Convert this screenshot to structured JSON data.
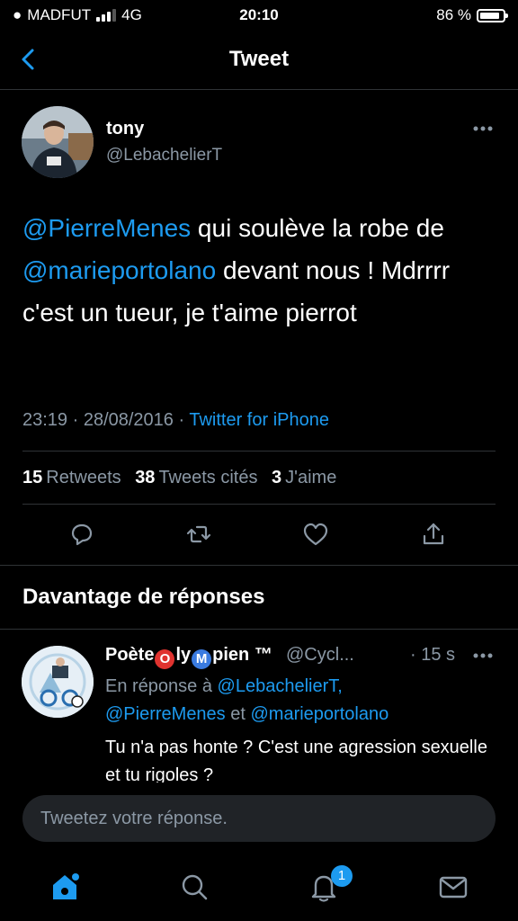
{
  "status_bar": {
    "carrier": "MADFUT",
    "network": "4G",
    "time": "20:10",
    "battery": "86 %",
    "battery_level": 0.86
  },
  "nav": {
    "title": "Tweet",
    "back_icon": "chevron-left-icon"
  },
  "tweet": {
    "name": "tony",
    "handle": "@LebachelierT",
    "text": {
      "mention1": "@PierreMenes",
      "part1": " qui soulève la robe de ",
      "mention2": "@marieportolano",
      "part2": " devant nous ! Mdrrrr c'est un tueur, je t'aime pierrot"
    },
    "time": "23:19 · 28/08/2016 · ",
    "source": "Twitter for iPhone",
    "stats": {
      "retweets_count": "15",
      "retweets_label": "Retweets",
      "quotes_count": "38",
      "quotes_label": "Tweets cités",
      "likes_count": "3",
      "likes_label": "J'aime"
    }
  },
  "more_replies_title": "Davantage de réponses",
  "reply": {
    "name_a": "Poète",
    "name_b": "ly",
    "name_c": "pien ™",
    "emoji1": "O",
    "emoji2": "M",
    "handle": "@Cycl...",
    "time": "· 15 s",
    "in_reply_to_label": "En réponse à ",
    "in_reply_to_1": "@LebachelierT,",
    "in_reply_to_2": "@PierreMenes",
    "in_reply_to_and": " et ",
    "in_reply_to_3": "@marieportolano",
    "text": "Tu n'a pas honte ? C'est une agression sexuelle et tu rigoles ?"
  },
  "composer": {
    "placeholder": "Tweetez votre réponse."
  },
  "tabbar": {
    "notification_badge": "1"
  },
  "colors": {
    "accent": "#1d9bf0",
    "muted": "#8b98a5",
    "background": "#000000"
  }
}
